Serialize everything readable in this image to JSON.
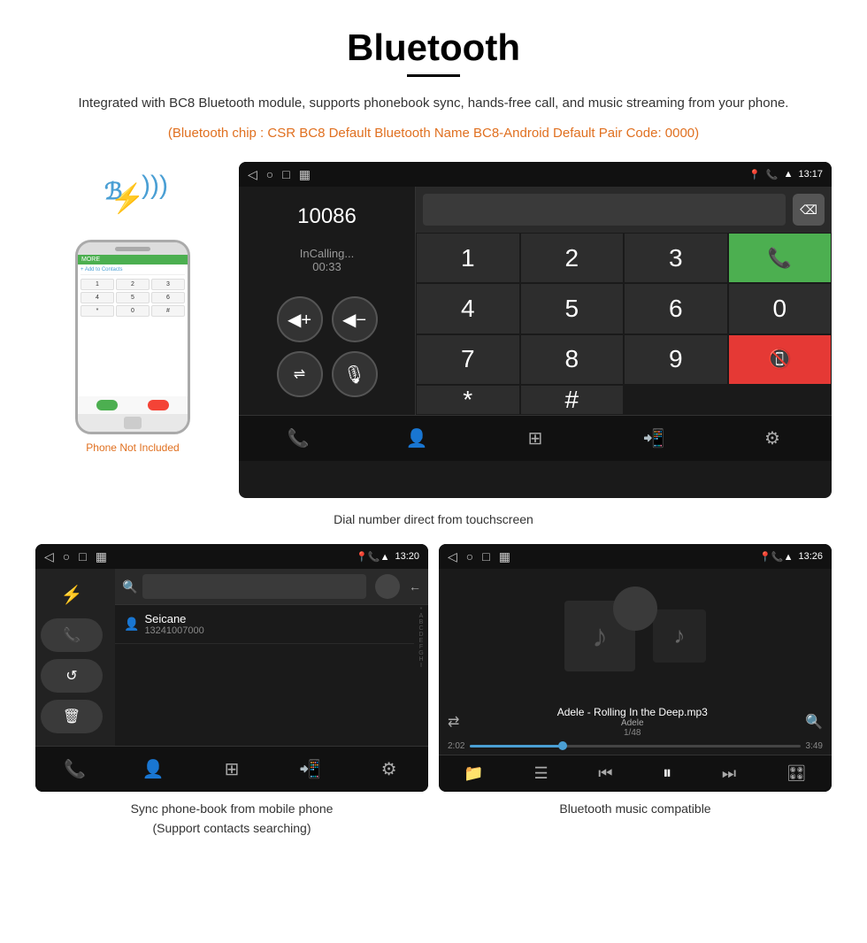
{
  "page": {
    "title": "Bluetooth",
    "description": "Integrated with BC8 Bluetooth module, supports phonebook sync, hands-free call, and music streaming from your phone.",
    "orange_info": "(Bluetooth chip : CSR BC8    Default Bluetooth Name BC8-Android    Default Pair Code: 0000)",
    "dial_caption": "Dial number direct from touchscreen",
    "phonebook_caption": "Sync phone-book from mobile phone\n(Support contacts searching)",
    "music_caption": "Bluetooth music compatible",
    "phone_not_included": "Phone Not Included"
  },
  "dial_screen": {
    "time": "13:17",
    "number": "10086",
    "calling_label": "InCalling...",
    "timer": "00:33",
    "keypad": [
      "1",
      "2",
      "3",
      "*",
      "4",
      "5",
      "6",
      "0",
      "7",
      "8",
      "9",
      "#"
    ]
  },
  "phonebook_screen": {
    "time": "13:20",
    "contact_name": "Seicane",
    "contact_number": "13241007000",
    "alphabet": [
      "*",
      "A",
      "B",
      "C",
      "D",
      "E",
      "F",
      "G",
      "H",
      "I"
    ]
  },
  "music_screen": {
    "time": "13:26",
    "song_title": "Adele - Rolling In the Deep.mp3",
    "artist": "Adele",
    "track_info": "1/48",
    "time_current": "2:02",
    "time_total": "3:49"
  },
  "icons": {
    "bluetooth": "✦",
    "back": "◁",
    "home": "○",
    "square": "□",
    "call_active": "📞",
    "call_end": "📵",
    "volume_up": "🔊",
    "volume_down": "🔉",
    "transfer": "⇄",
    "mic": "🎤",
    "phone_book": "👤",
    "grid": "⊞",
    "phone_transfer": "📲",
    "settings": "⚙",
    "search": "🔍",
    "shuffle": "⇄",
    "list": "☰",
    "prev": "⏮",
    "play": "⏸",
    "next": "⏭",
    "equalizer": "🎛",
    "folder": "📁",
    "delete": "⌫",
    "music_note": "♪"
  }
}
